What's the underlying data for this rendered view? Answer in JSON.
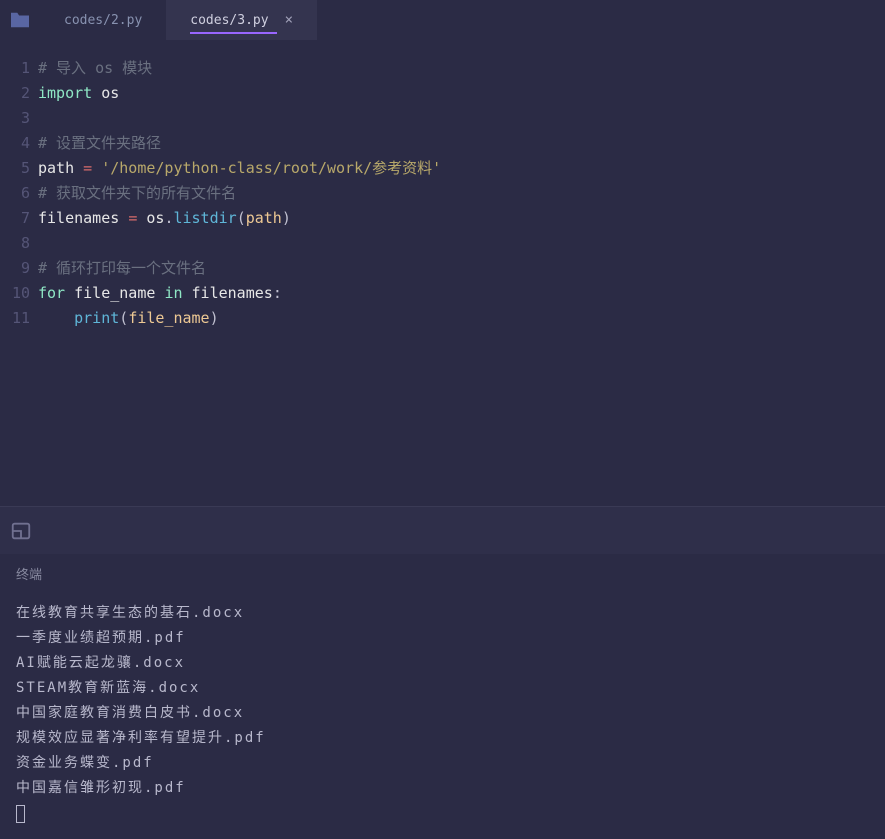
{
  "tabs": [
    {
      "label": "codes/2.py",
      "active": false
    },
    {
      "label": "codes/3.py",
      "active": true
    }
  ],
  "code": {
    "lines": [
      {
        "n": 1,
        "tokens": [
          {
            "t": "# 导入 os 模块",
            "c": "comment"
          }
        ]
      },
      {
        "n": 2,
        "tokens": [
          {
            "t": "import",
            "c": "keyword"
          },
          {
            "t": " ",
            "c": ""
          },
          {
            "t": "os",
            "c": "name"
          }
        ]
      },
      {
        "n": 3,
        "tokens": []
      },
      {
        "n": 4,
        "tokens": [
          {
            "t": "# 设置文件夹路径",
            "c": "comment"
          }
        ]
      },
      {
        "n": 5,
        "tokens": [
          {
            "t": "path",
            "c": "name"
          },
          {
            "t": " ",
            "c": ""
          },
          {
            "t": "=",
            "c": "op"
          },
          {
            "t": " ",
            "c": ""
          },
          {
            "t": "'/home/python-class/root/work/参考资料'",
            "c": "string"
          }
        ]
      },
      {
        "n": 6,
        "tokens": [
          {
            "t": "# 获取文件夹下的所有文件名",
            "c": "comment"
          }
        ]
      },
      {
        "n": 7,
        "tokens": [
          {
            "t": "filenames",
            "c": "name"
          },
          {
            "t": " ",
            "c": ""
          },
          {
            "t": "=",
            "c": "op"
          },
          {
            "t": " ",
            "c": ""
          },
          {
            "t": "os",
            "c": "name"
          },
          {
            "t": ".",
            "c": "punc"
          },
          {
            "t": "listdir",
            "c": "func"
          },
          {
            "t": "(",
            "c": "punc"
          },
          {
            "t": "path",
            "c": "param"
          },
          {
            "t": ")",
            "c": "punc"
          }
        ]
      },
      {
        "n": 8,
        "tokens": []
      },
      {
        "n": 9,
        "tokens": [
          {
            "t": "# 循环打印每一个文件名",
            "c": "comment"
          }
        ]
      },
      {
        "n": 10,
        "tokens": [
          {
            "t": "for",
            "c": "keyword"
          },
          {
            "t": " ",
            "c": ""
          },
          {
            "t": "file_name",
            "c": "name"
          },
          {
            "t": " ",
            "c": ""
          },
          {
            "t": "in",
            "c": "keyword"
          },
          {
            "t": " ",
            "c": ""
          },
          {
            "t": "filenames",
            "c": "name"
          },
          {
            "t": ":",
            "c": "punc"
          }
        ]
      },
      {
        "n": 11,
        "tokens": [
          {
            "t": "    ",
            "c": ""
          },
          {
            "t": "print",
            "c": "builtin"
          },
          {
            "t": "(",
            "c": "punc"
          },
          {
            "t": "file_name",
            "c": "param"
          },
          {
            "t": ")",
            "c": "punc"
          }
        ]
      }
    ]
  },
  "terminal": {
    "title": "终端",
    "output": [
      "在线教育共享生态的基石.docx",
      "一季度业绩超预期.pdf",
      "AI赋能云起龙骧.docx",
      "STEAM教育新蓝海.docx",
      "中国家庭教育消费白皮书.docx",
      "规模效应显著净利率有望提升.pdf",
      "资金业务蝶变.pdf",
      "中国嘉信雏形初现.pdf"
    ]
  }
}
